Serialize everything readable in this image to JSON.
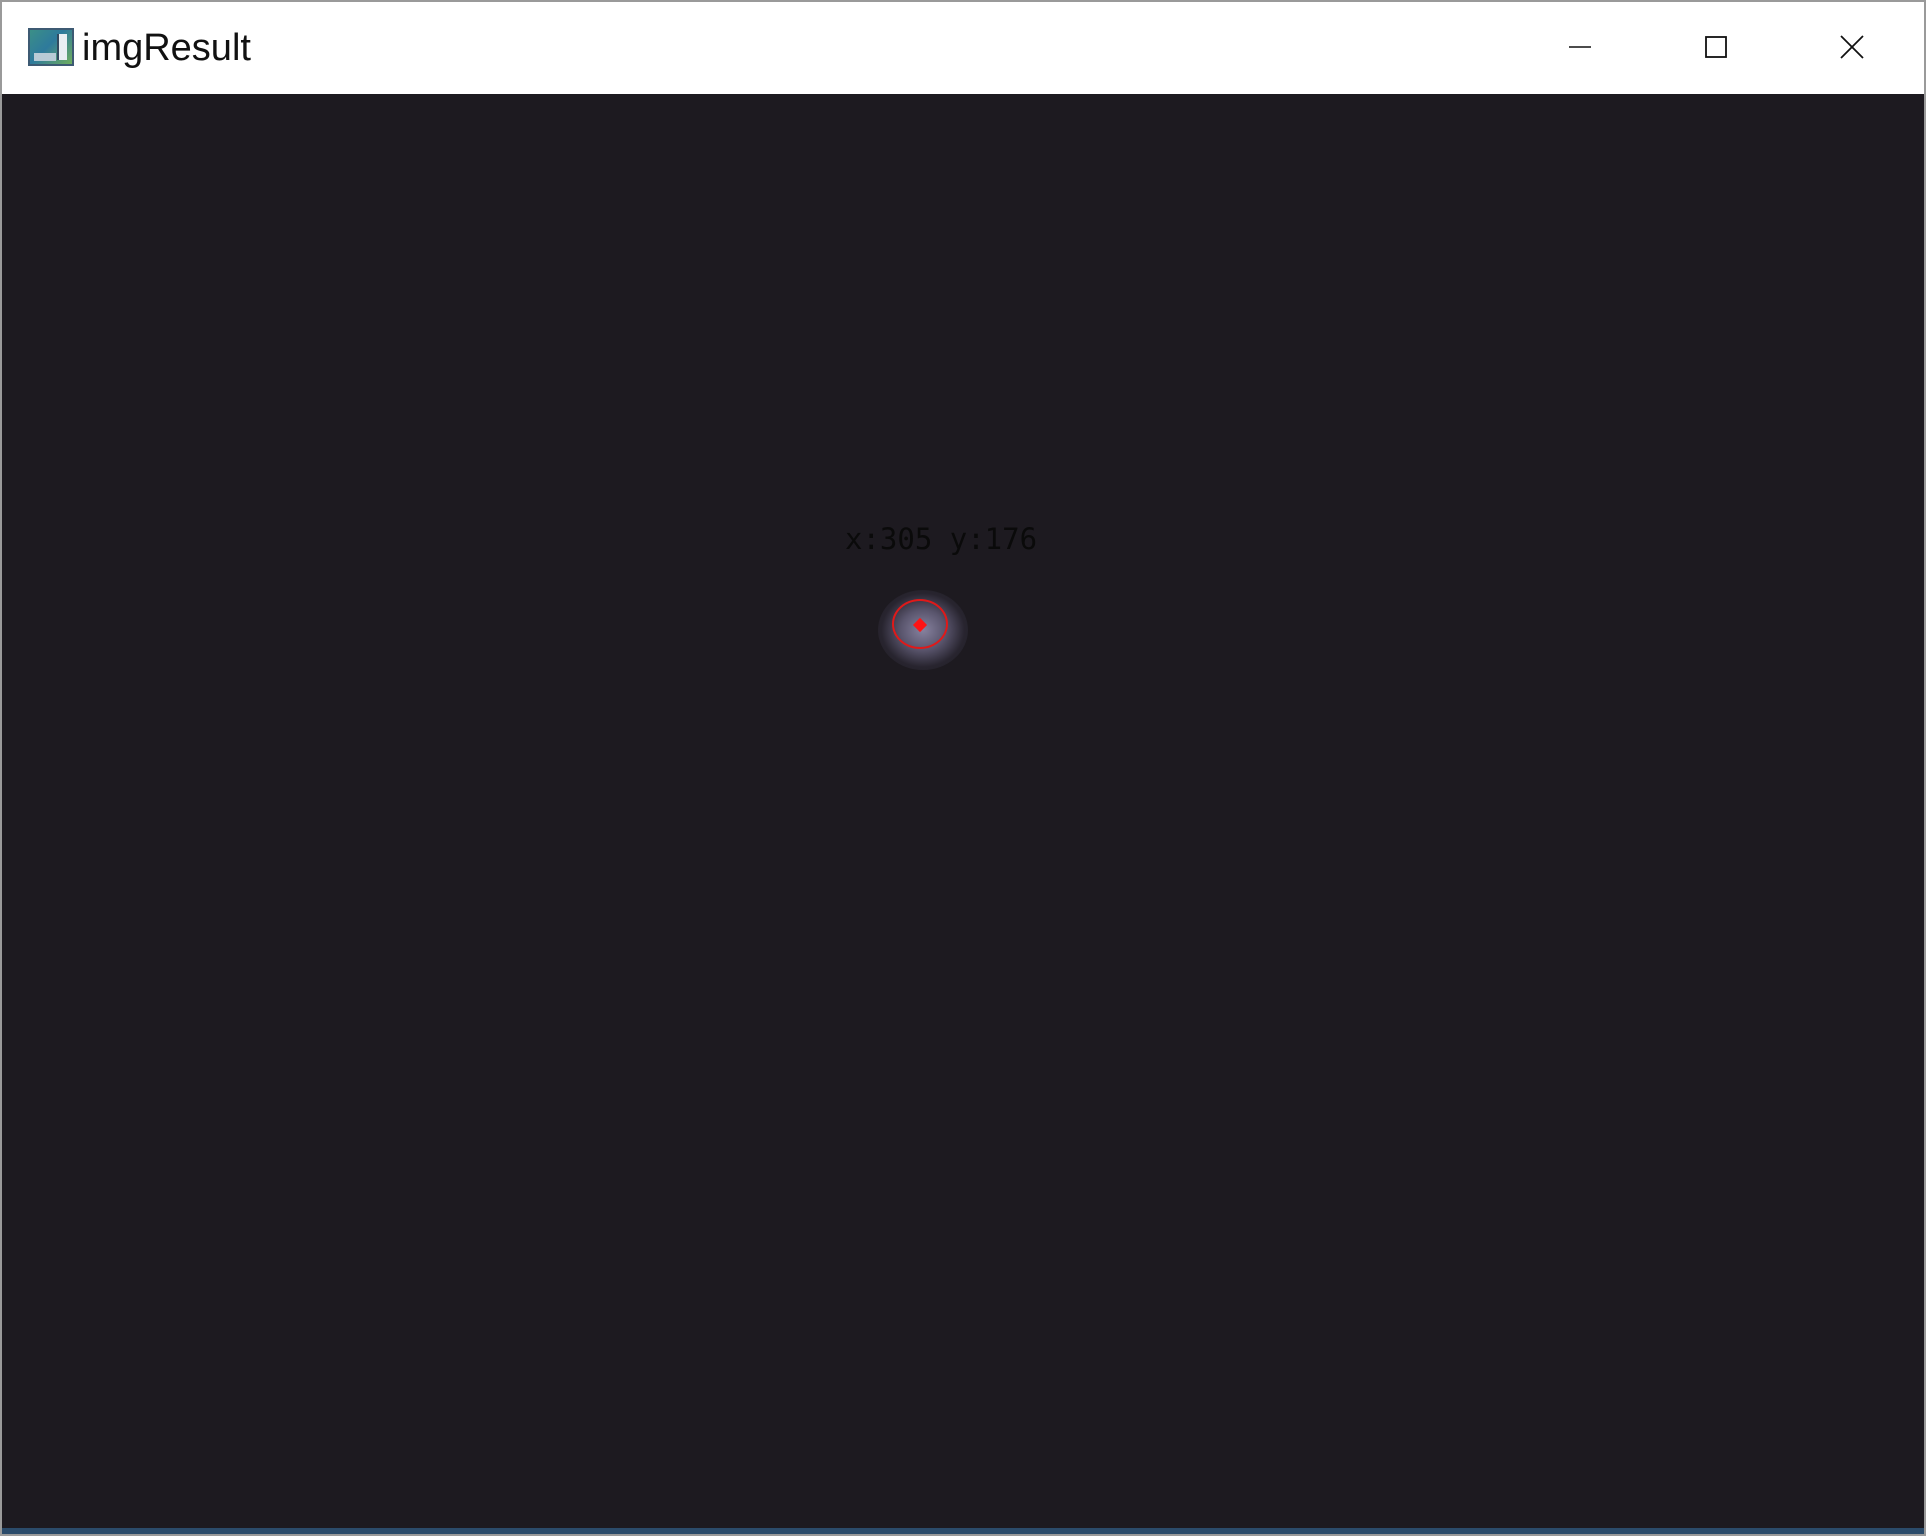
{
  "window": {
    "title": "imgResult",
    "icon": "opencv-window-icon"
  },
  "controls": {
    "minimize_icon": "minimize-icon",
    "maximize_icon": "maximize-icon",
    "close_icon": "close-icon"
  },
  "canvas": {
    "background_color": "#1d1a20",
    "coord_text": "x:305 y:176",
    "marker_color": "#e01919"
  }
}
